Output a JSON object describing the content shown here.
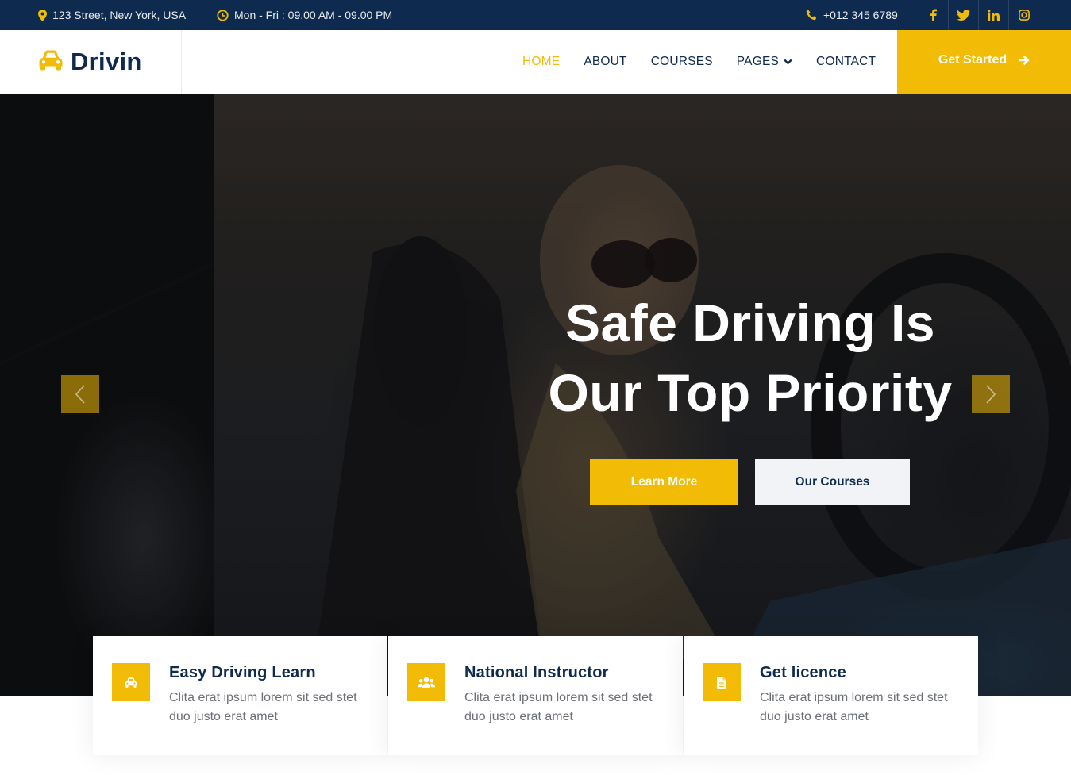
{
  "topbar": {
    "address": "123 Street, New York, USA",
    "hours": "Mon - Fri : 09.00 AM - 09.00 PM",
    "phone": "+012 345 6789",
    "social": [
      {
        "name": "facebook",
        "glyph": "f"
      },
      {
        "name": "twitter",
        "glyph": "twitter"
      },
      {
        "name": "linkedin",
        "glyph": "in"
      },
      {
        "name": "instagram",
        "glyph": "instagram"
      }
    ]
  },
  "navbar": {
    "brand": "Drivin",
    "links": [
      {
        "label": "HOME",
        "active": true
      },
      {
        "label": "ABOUT",
        "active": false
      },
      {
        "label": "COURSES",
        "active": false
      },
      {
        "label": "PAGES",
        "active": false,
        "dropdown": true
      },
      {
        "label": "CONTACT",
        "active": false
      }
    ],
    "cta": "Get Started"
  },
  "hero": {
    "title_line1": "Safe Driving Is",
    "title_line2": "Our Top Priority",
    "primary_button": "Learn More",
    "secondary_button": "Our Courses"
  },
  "features": [
    {
      "icon": "car-icon",
      "title": "Easy Driving Learn",
      "text": "Clita erat ipsum lorem sit sed stet duo justo erat amet"
    },
    {
      "icon": "users-icon",
      "title": "National Instructor",
      "text": "Clita erat ipsum lorem sit sed stet duo justo erat amet"
    },
    {
      "icon": "file-icon",
      "title": "Get licence",
      "text": "Clita erat ipsum lorem sit sed stet duo justo erat amet"
    }
  ],
  "colors": {
    "primary": "#f2bb05",
    "dark": "#0f2a4f",
    "light": "#f1f3f7"
  }
}
